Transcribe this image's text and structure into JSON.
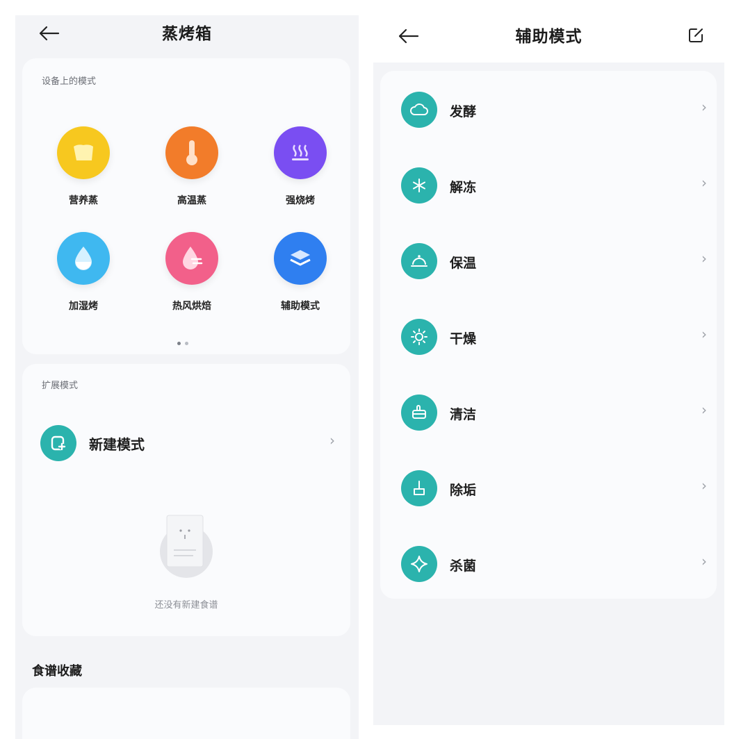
{
  "left": {
    "title": "蒸烤箱",
    "device_modes_label": "设备上的模式",
    "modes": [
      {
        "label": "营养蒸",
        "icon": "steam-bread-icon",
        "color": "#f7c81f"
      },
      {
        "label": "高温蒸",
        "icon": "thermometer-icon",
        "color": "#f27c2a"
      },
      {
        "label": "强烧烤",
        "icon": "grill-heat-icon",
        "color": "#7a4ef2"
      },
      {
        "label": "加湿烤",
        "icon": "water-drop-icon",
        "color": "#3fb8f0"
      },
      {
        "label": "热风烘焙",
        "icon": "hot-air-drop-icon",
        "color": "#f2608a"
      },
      {
        "label": "辅助模式",
        "icon": "layers-icon",
        "color": "#2f7ff0"
      }
    ],
    "pager": {
      "pages": 2,
      "current": 1
    },
    "extended_label": "扩展模式",
    "new_mode_label": "新建模式",
    "empty_text": "还没有新建食谱",
    "favorites_label": "食谱收藏"
  },
  "right": {
    "title": "辅助模式",
    "items": [
      {
        "label": "发酵",
        "icon": "cloud-icon"
      },
      {
        "label": "解冻",
        "icon": "snowflake-icon"
      },
      {
        "label": "保温",
        "icon": "dish-cover-icon"
      },
      {
        "label": "干燥",
        "icon": "sun-icon"
      },
      {
        "label": "清洁",
        "icon": "cleaning-icon"
      },
      {
        "label": "除垢",
        "icon": "broom-icon"
      },
      {
        "label": "杀菌",
        "icon": "sparkle-icon"
      }
    ]
  },
  "colors": {
    "teal": "#2bb3ad",
    "panel": "#f3f4f7",
    "card": "#fafbfd"
  }
}
